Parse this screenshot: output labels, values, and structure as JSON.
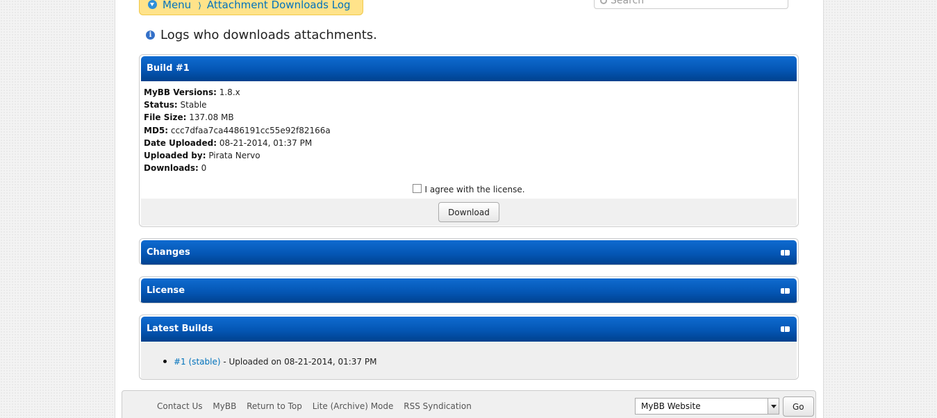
{
  "breadcrumb": {
    "menu_label": "Menu",
    "separator": "⟩",
    "current_label": "Attachment Downloads Log"
  },
  "search": {
    "placeholder": "Search"
  },
  "intro": {
    "text": "Logs who downloads attachments."
  },
  "build_panel": {
    "title": "Build #1",
    "fields": [
      {
        "label": "MyBB Versions:",
        "value": "1.8.x"
      },
      {
        "label": "Status:",
        "value": "Stable"
      },
      {
        "label": "File Size:",
        "value": "137.08 MB"
      },
      {
        "label": "MD5:",
        "value": "ccc7dfaa7ca4486191cc55e92f82166a"
      },
      {
        "label": "Date Uploaded:",
        "value": "08-21-2014, 01:37 PM"
      },
      {
        "label": "Uploaded by:",
        "value": "Pirata Nervo"
      },
      {
        "label": "Downloads:",
        "value": "0"
      }
    ],
    "agree_label": "I agree with the license.",
    "download_button": "Download"
  },
  "changes_panel": {
    "title": "Changes"
  },
  "license_panel": {
    "title": "License"
  },
  "latest_builds": {
    "title": "Latest Builds",
    "items": [
      {
        "link": "#1 (stable)",
        "text": " - Uploaded on 08-21-2014, 01:37 PM"
      }
    ]
  },
  "footer": {
    "links": [
      "Contact Us",
      "MyBB",
      "Return to Top",
      "Lite (Archive) Mode",
      "RSS Syndication"
    ],
    "theme_select": "MyBB Website",
    "go_button": "Go"
  },
  "colors": {
    "header_blue": "#0456b4",
    "link_blue": "#0072bc",
    "breadcrumb_bg": "#ffe38a"
  }
}
